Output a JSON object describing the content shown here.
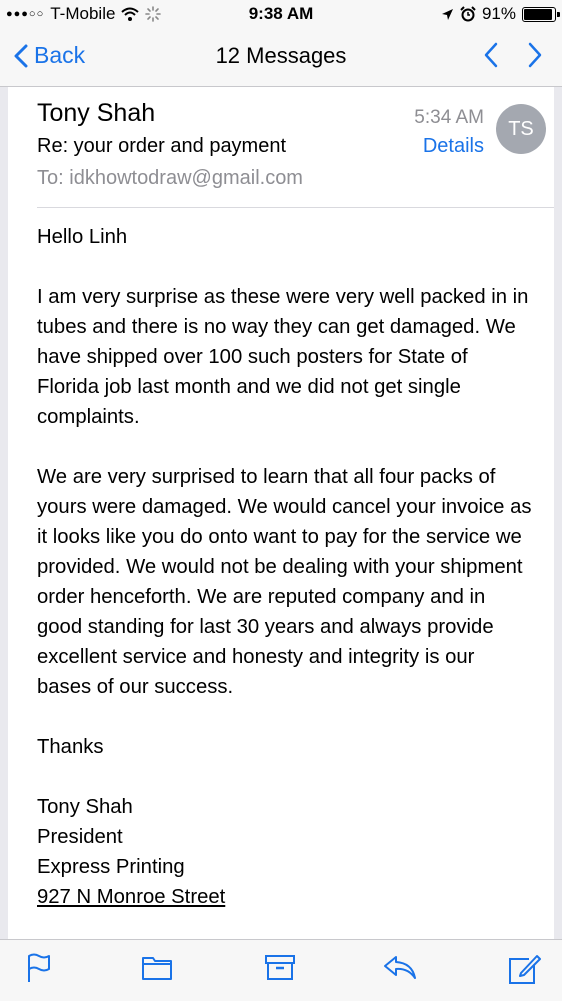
{
  "status_bar": {
    "carrier": "T-Mobile",
    "time": "9:38 AM",
    "battery": "91%"
  },
  "nav": {
    "back_label": "Back",
    "title": "12 Messages"
  },
  "email": {
    "sender": "Tony Shah",
    "subject": "Re: your order and payment",
    "to_label": "To:",
    "to_address": "idkhowtodraw@gmail.com",
    "time": "5:34 AM",
    "details_label": "Details",
    "avatar_initials": "TS",
    "body": {
      "greeting": "Hello Linh",
      "p1": "I am very surprise as these were very well packed in in tubes and there is no way they can get damaged. We have shipped over 100 such posters for State of Florida job last month and we did not get single complaints.",
      "p2": "We are very surprised to learn that all four packs of yours were damaged. We would cancel your invoice as it looks like you do onto want to pay for the service we provided.  We would not be dealing with your shipment order henceforth. We are reputed company and in good standing for last 30 years and always provide excellent service and honesty and integrity is our bases of our success.",
      "closing": "Thanks",
      "sig_name": "Tony Shah",
      "sig_title": "President",
      "sig_company": "Express Printing",
      "sig_address": "927 N Monroe Street"
    }
  },
  "colors": {
    "accent": "#1a73e8",
    "secondary_text": "#8e8e93",
    "avatar": "#a4a8b0"
  },
  "icons": [
    "wifi-icon",
    "location-icon",
    "alarm-icon",
    "back-chevron-icon",
    "previous-message-icon",
    "next-message-icon",
    "flag-icon",
    "folder-icon",
    "archive-icon",
    "reply-icon",
    "compose-icon"
  ]
}
